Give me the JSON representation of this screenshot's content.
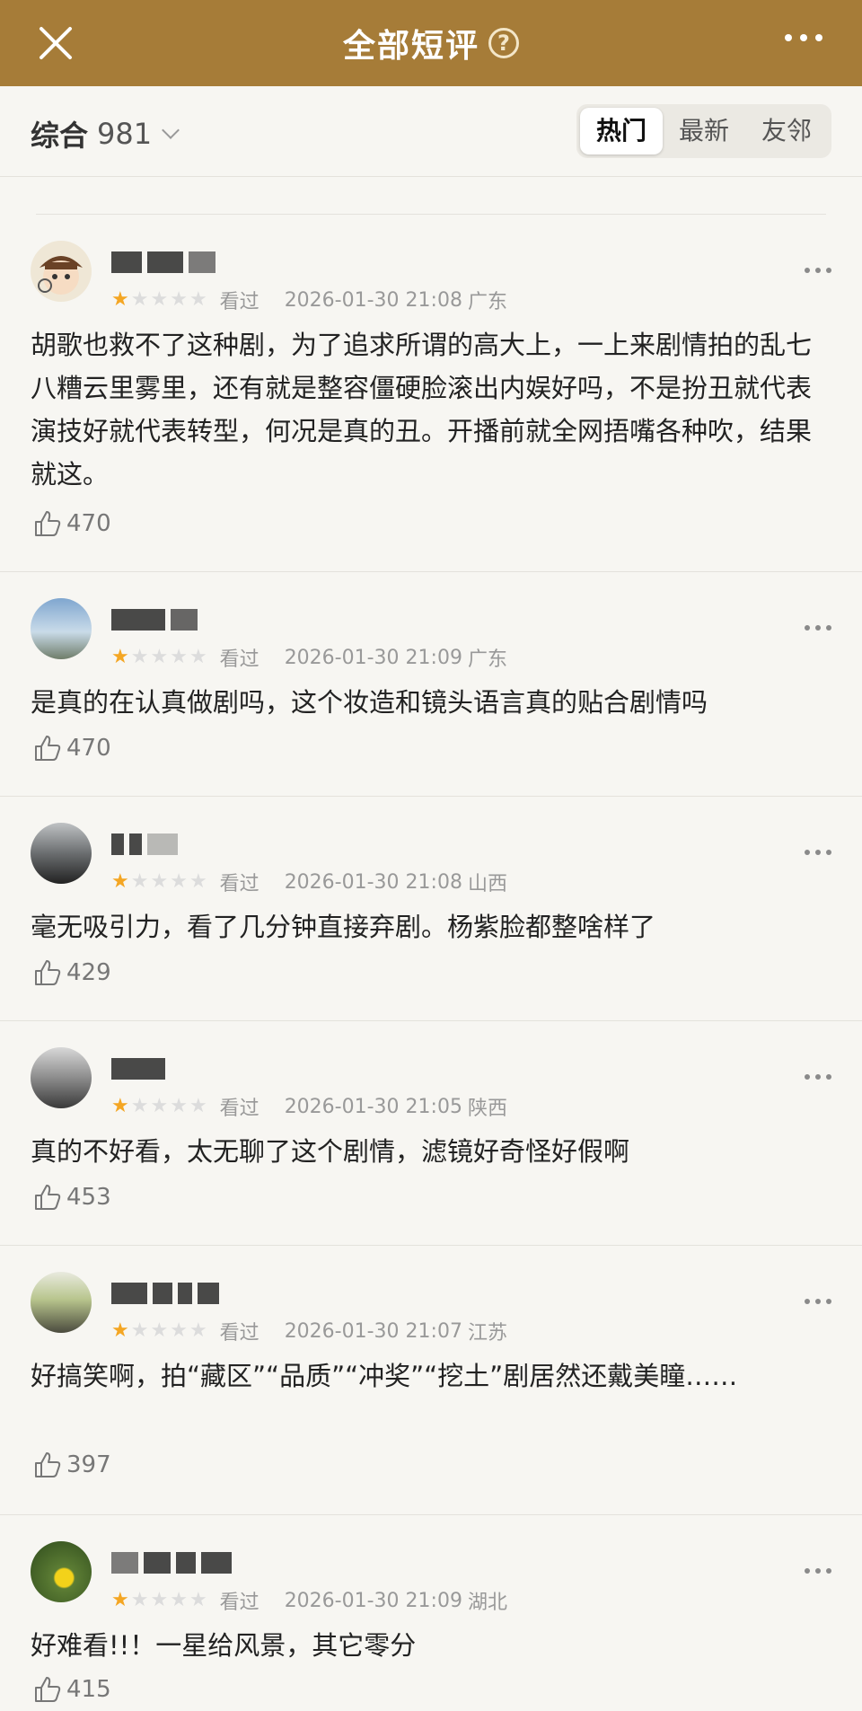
{
  "header": {
    "title": "全部短评",
    "help_icon": "help-circle-icon"
  },
  "filter": {
    "sort_label": "综合",
    "count": "981",
    "tabs": [
      {
        "label": "热门"
      },
      {
        "label": "最新"
      },
      {
        "label": "友邻"
      }
    ],
    "active_tab": "热门"
  },
  "colors": {
    "header_bg": "#a67c38",
    "star_on": "#f4a623",
    "star_off": "#dcdcdc"
  },
  "reviews": [
    {
      "stars": 1,
      "status": "看过",
      "time": "2026-01-30 21:08",
      "location": "广东",
      "text": "胡歌也救不了这种剧，为了追求所谓的高大上，一上来剧情拍的乱七八糟云里雾里，还有就是整容僵硬脸滚出内娱好吗，不是扮丑就代表演技好就代表转型，何况是真的丑。开播前就全网捂嘴各种吹，结果就这。",
      "likes": "470"
    },
    {
      "stars": 1,
      "status": "看过",
      "time": "2026-01-30 21:09",
      "location": "广东",
      "text": "是真的在认真做剧吗，这个妆造和镜头语言真的贴合剧情吗",
      "likes": "470"
    },
    {
      "stars": 1,
      "status": "看过",
      "time": "2026-01-30 21:08",
      "location": "山西",
      "text": "毫无吸引力，看了几分钟直接弃剧。杨紫脸都整啥样了",
      "likes": "429"
    },
    {
      "stars": 1,
      "status": "看过",
      "time": "2026-01-30 21:05",
      "location": "陕西",
      "text": "真的不好看，太无聊了这个剧情，滤镜好奇怪好假啊",
      "likes": "453"
    },
    {
      "stars": 1,
      "status": "看过",
      "time": "2026-01-30 21:07",
      "location": "江苏",
      "text": "好搞笑啊，拍“藏区”“品质”“冲奖”“挖土”剧居然还戴美瞳……",
      "likes": "397"
    },
    {
      "stars": 1,
      "status": "看过",
      "time": "2026-01-30 21:09",
      "location": "湖北",
      "text": "好难看!!！一星给风景，其它零分",
      "likes": "415"
    }
  ]
}
